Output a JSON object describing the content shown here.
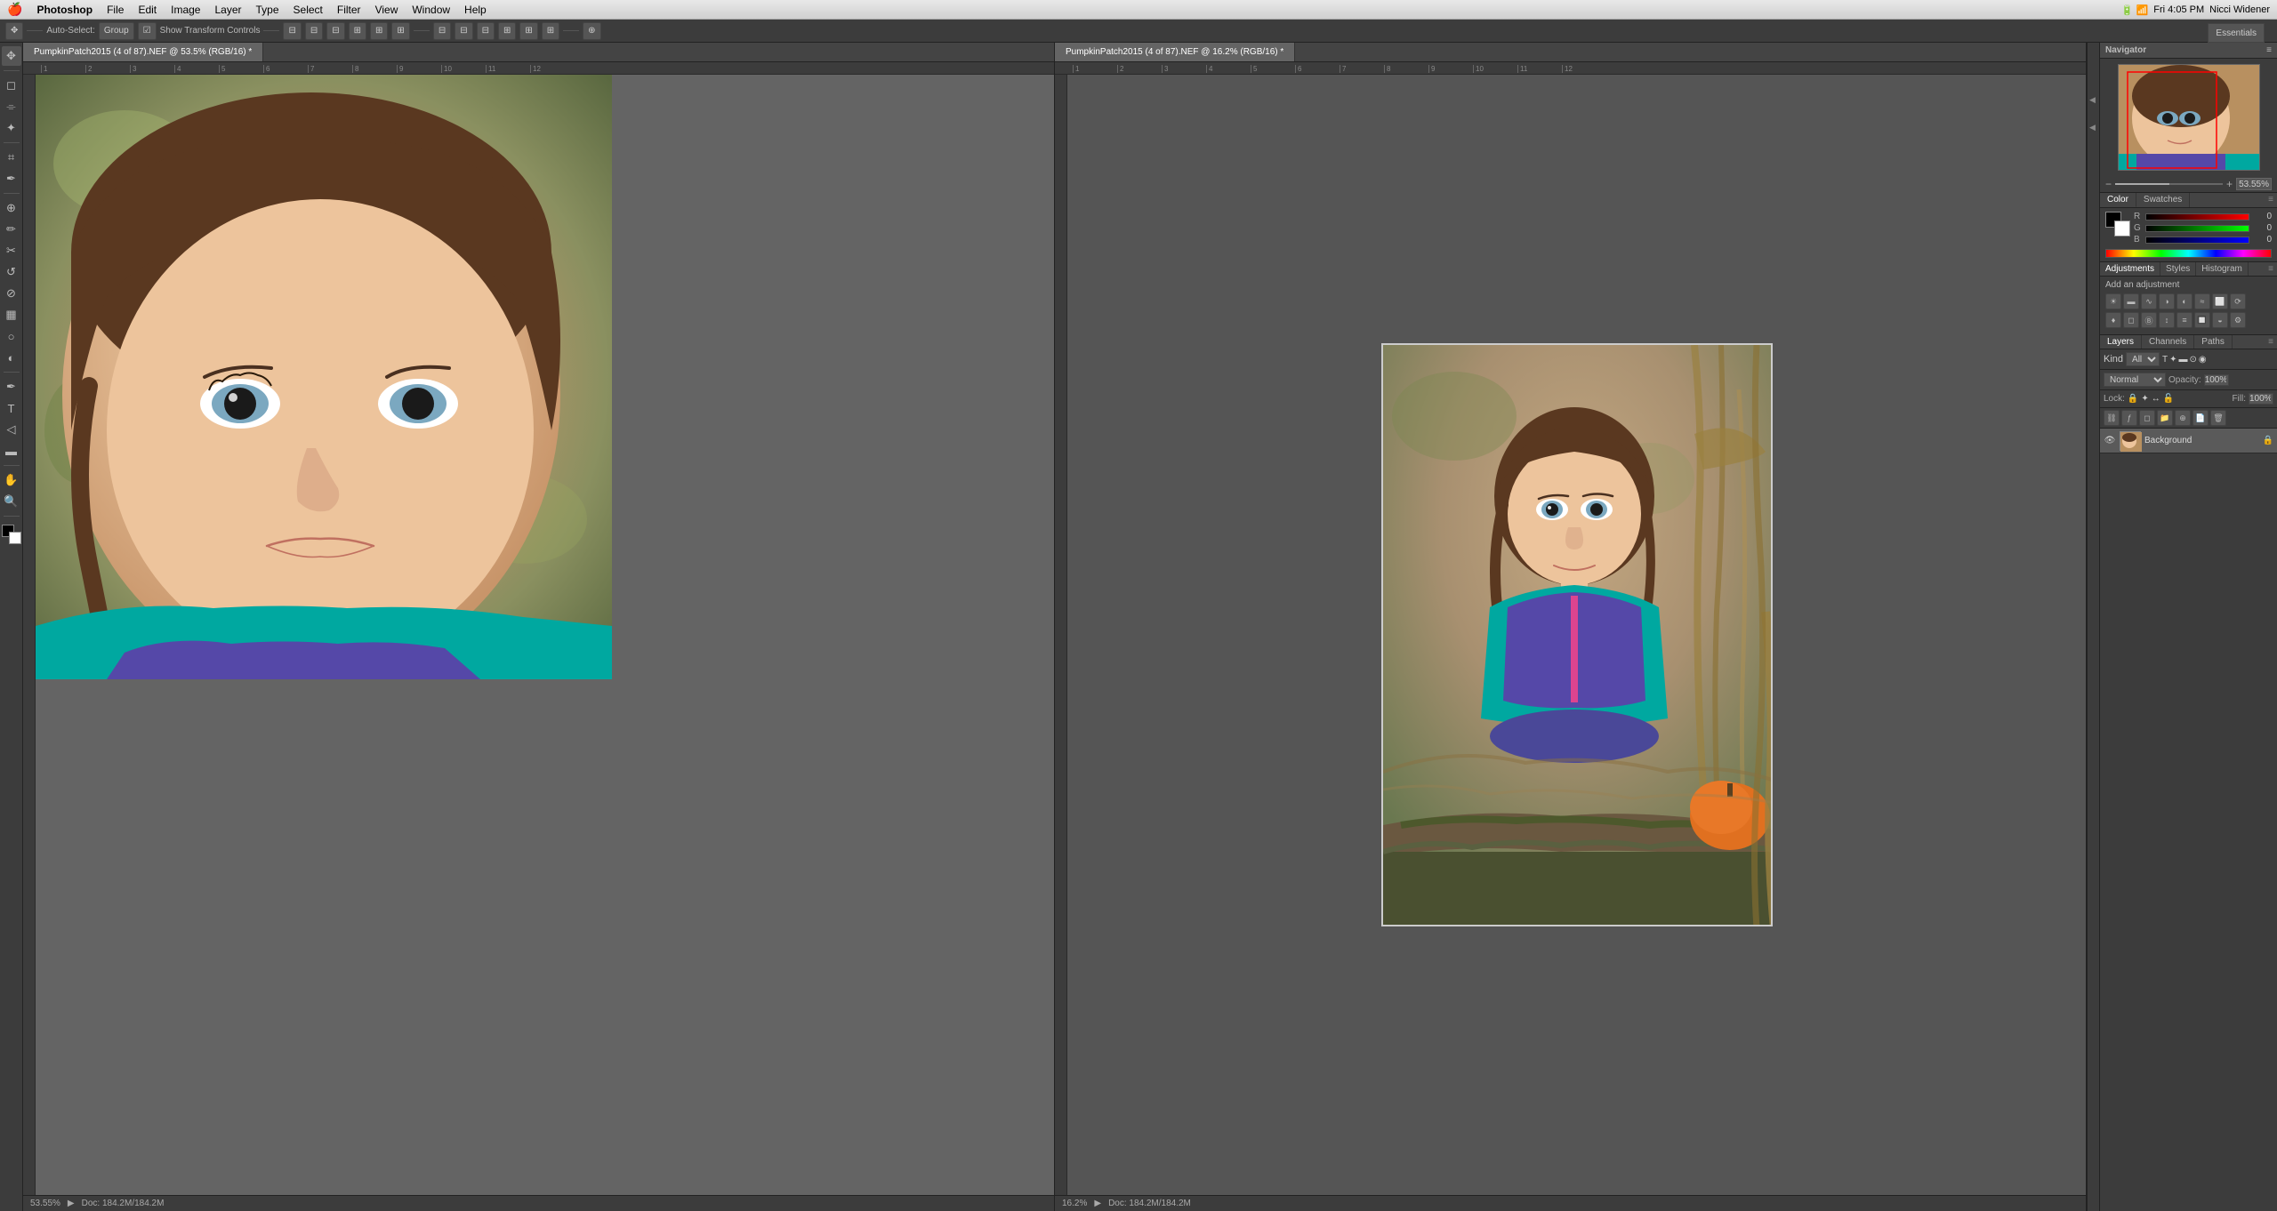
{
  "menubar": {
    "apple": "🍎",
    "items": [
      "Photoshop",
      "File",
      "Edit",
      "Image",
      "Layer",
      "Type",
      "Select",
      "Filter",
      "View",
      "Window",
      "Help"
    ],
    "right": {
      "time": "Fri 4:05 PM",
      "user": "Nicci Widener"
    }
  },
  "toolbar": {
    "tool_options": {
      "auto_select_label": "Auto-Select:",
      "auto_select_value": "Group",
      "show_transform": "Show Transform Controls"
    },
    "essentials": "Essentials"
  },
  "docs": {
    "left": {
      "tab": "PumpkinPatch2015 (4 of 87).NEF @ 53.5% (RGB/16) *",
      "zoom": "53.55%",
      "status": "Doc: 184.2M/184.2M"
    },
    "right": {
      "tab": "PumpkinPatch2015 (4 of 87).NEF @ 16.2% (RGB/16) *",
      "zoom": "16.2%",
      "status": "Doc: 184.2M/184.2M"
    }
  },
  "navigator": {
    "title": "Navigator",
    "zoom_value": "53.55%"
  },
  "color_panel": {
    "tabs": [
      "Color",
      "Swatches"
    ],
    "r_label": "R",
    "g_label": "G",
    "b_label": "B",
    "r_value": "0",
    "g_value": "0",
    "b_value": "0"
  },
  "adjustments_panel": {
    "tabs": [
      "Adjustments",
      "Styles",
      "Histogram"
    ],
    "title": "Add an adjustment",
    "icons": [
      "☀",
      "◑",
      "◐",
      "≈",
      "⬜",
      "⟳",
      "♦",
      "◻",
      "Ⓑ",
      "🎨",
      "↕",
      "≡",
      "🔲",
      "◒",
      "⚙",
      "🔶",
      "⬛"
    ]
  },
  "layers_panel": {
    "tabs": [
      "Layers",
      "Channels",
      "Paths"
    ],
    "kind_label": "Kind",
    "normal_label": "Normal",
    "opacity_label": "Opacity:",
    "opacity_value": "100%",
    "fill_label": "Fill:",
    "fill_value": "100%",
    "lock_icons": [
      "🔒",
      "✦",
      "↔",
      "🔓"
    ],
    "layers": [
      {
        "name": "Background",
        "visible": true,
        "locked": true
      }
    ]
  },
  "icons": {
    "move": "✥",
    "selection": "◻",
    "lasso": "⌯",
    "crop": "⌗",
    "eyedropper": "✒",
    "spot_heal": "⊕",
    "brush": "✏",
    "clone": "✂",
    "eraser": "⊘",
    "gradient": "▦",
    "blur": "○",
    "dodge": "◐",
    "pen": "✒",
    "type": "T",
    "path_select": "◁",
    "shapes": "▬",
    "hand": "✋",
    "zoom": "⊕",
    "eye": "👁"
  }
}
